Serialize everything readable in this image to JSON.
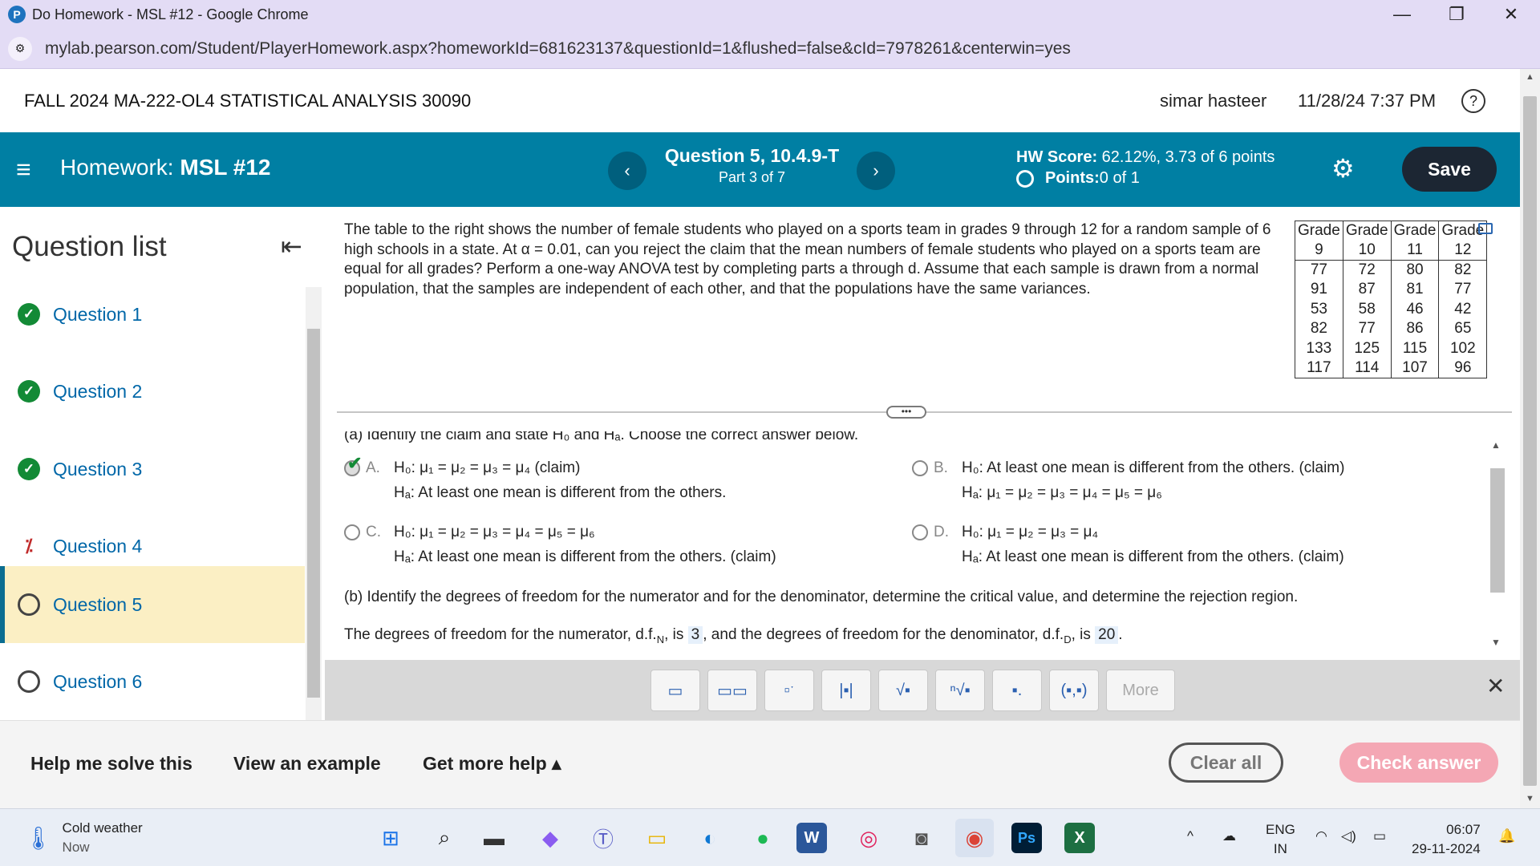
{
  "browser": {
    "favicon_letter": "P",
    "tab_title": "Do Homework - MSL #12 - Google Chrome",
    "url": "mylab.pearson.com/Student/PlayerHomework.aspx?homeworkId=681623137&questionId=1&flushed=false&cId=7978261&centerwin=yes",
    "minimize_icon": "—",
    "restore_icon": "❐",
    "close_icon": "✕",
    "site_icon": "⚙"
  },
  "course": {
    "name": "FALL 2024 MA-222-OL4 STATISTICAL ANALYSIS 30090",
    "user": "simar hasteer",
    "datetime": "11/28/24 7:37 PM",
    "help": "?"
  },
  "hwbar": {
    "menu_icon": "≡",
    "label_prefix": "Homework: ",
    "label_name": "MSL #12",
    "prev": "‹",
    "next": "›",
    "question_title": "Question 5, 10.4.9-T",
    "question_part": "Part 3 of 7",
    "score_label": "HW Score:",
    "score_value": " 62.12%, 3.73 of 6 points",
    "points_label": "Points:",
    "points_value": " 0 of 1",
    "gear": "⚙",
    "save": "Save"
  },
  "sidebar": {
    "heading": "Question list",
    "collapse_icon": "⇤",
    "items": [
      {
        "label": "Question 1",
        "status": "done",
        "icon": "✓"
      },
      {
        "label": "Question 2",
        "status": "done",
        "icon": "✓"
      },
      {
        "label": "Question 3",
        "status": "done",
        "icon": "✓"
      },
      {
        "label": "Question 4",
        "status": "partial",
        "icon": "⁒"
      },
      {
        "label": "Question 5",
        "status": "open",
        "icon": ""
      },
      {
        "label": "Question 6",
        "status": "open",
        "icon": ""
      }
    ]
  },
  "problem": {
    "text": "The table to the right shows the number of female students who played on a sports team in grades 9 through 12 for a random sample of 6 high schools in a state. At α = 0.01, can you reject the claim that the mean numbers of female students who played on a sports team are equal for all grades? Perform a one-way ANOVA test by completing parts a through d. Assume that each sample is drawn from a normal population, that the samples are independent of each other, and that the populations have the same variances.",
    "table": {
      "header_top": [
        "Grade",
        "Grade",
        "Grade",
        "Grade"
      ],
      "header_bottom": [
        "9",
        "10",
        "11",
        "12"
      ],
      "rows": [
        [
          "77",
          "72",
          "80",
          "82"
        ],
        [
          "91",
          "87",
          "81",
          "77"
        ],
        [
          "53",
          "58",
          "46",
          "42"
        ],
        [
          "82",
          "77",
          "86",
          "65"
        ],
        [
          "133",
          "125",
          "115",
          "102"
        ],
        [
          "117",
          "114",
          "107",
          "96"
        ]
      ]
    },
    "divider_grip": "•••"
  },
  "part_a": {
    "prompt": "(a) Identify the claim and state H₀ and Hₐ. Choose the correct answer below.",
    "options": [
      {
        "letter": "A.",
        "line1": "H₀: μ₁ = μ₂ = μ₃ = μ₄ (claim)",
        "line2": "Hₐ: At least one mean is different from the others.",
        "selected": true
      },
      {
        "letter": "B.",
        "line1": "H₀: At least one mean is different from the others. (claim)",
        "line2": "Hₐ: μ₁ = μ₂ = μ₃ = μ₄ = μ₅ = μ₆",
        "selected": false
      },
      {
        "letter": "C.",
        "line1": "H₀: μ₁ = μ₂ = μ₃ = μ₄ = μ₅ = μ₆",
        "line2": "Hₐ: At least one mean is different from the others. (claim)",
        "selected": false
      },
      {
        "letter": "D.",
        "line1": "H₀: μ₁ = μ₂ = μ₃ = μ₄",
        "line2": "Hₐ: At least one mean is different from the others. (claim)",
        "selected": false
      }
    ],
    "check_mark": "✔"
  },
  "part_b": {
    "prompt": "(b) Identify the degrees of freedom for the numerator and for the denominator, determine the critical value, and determine the rejection region.",
    "df_text1": "The degrees of freedom for the numerator, d.f.",
    "df_sub1": "N",
    "df_text2": ", is ",
    "df_num": "3",
    "df_text3": ", and the degrees of freedom for the denominator, d.f.",
    "df_sub2": "D",
    "df_text4": ", is ",
    "df_den": "20",
    "df_text5": "."
  },
  "mathbar": {
    "buttons": [
      "▭",
      "▭▭",
      "▫ˑ",
      "|▪|",
      "√▪",
      "ⁿ√▪",
      "▪.",
      "(▪,▪)"
    ],
    "more": "More",
    "close": "✕"
  },
  "footer": {
    "help_solve": "Help me solve this",
    "view_example": "View an example",
    "more_help": "Get more help ▴",
    "clear_all": "Clear all",
    "check_answer": "Check answer"
  },
  "taskbar": {
    "weather_title": "Cold weather",
    "weather_sub": "Now",
    "weather_icon": "🌡",
    "apps": [
      "⊞",
      "⌕",
      "▬",
      "◆",
      "Ⓣ",
      "▭",
      "◐",
      "●",
      "W",
      "◎",
      "◙",
      "◉",
      "Ps",
      "X"
    ],
    "lang_top": "ENG",
    "lang_bottom": "IN",
    "time": "06:07",
    "date": "29-11-2024",
    "tray_up": "^",
    "tray_cloud": "☁",
    "tray_wifi": "◠",
    "tray_vol": "◁)",
    "tray_bat": "▭",
    "tray_bell": "🔔"
  }
}
